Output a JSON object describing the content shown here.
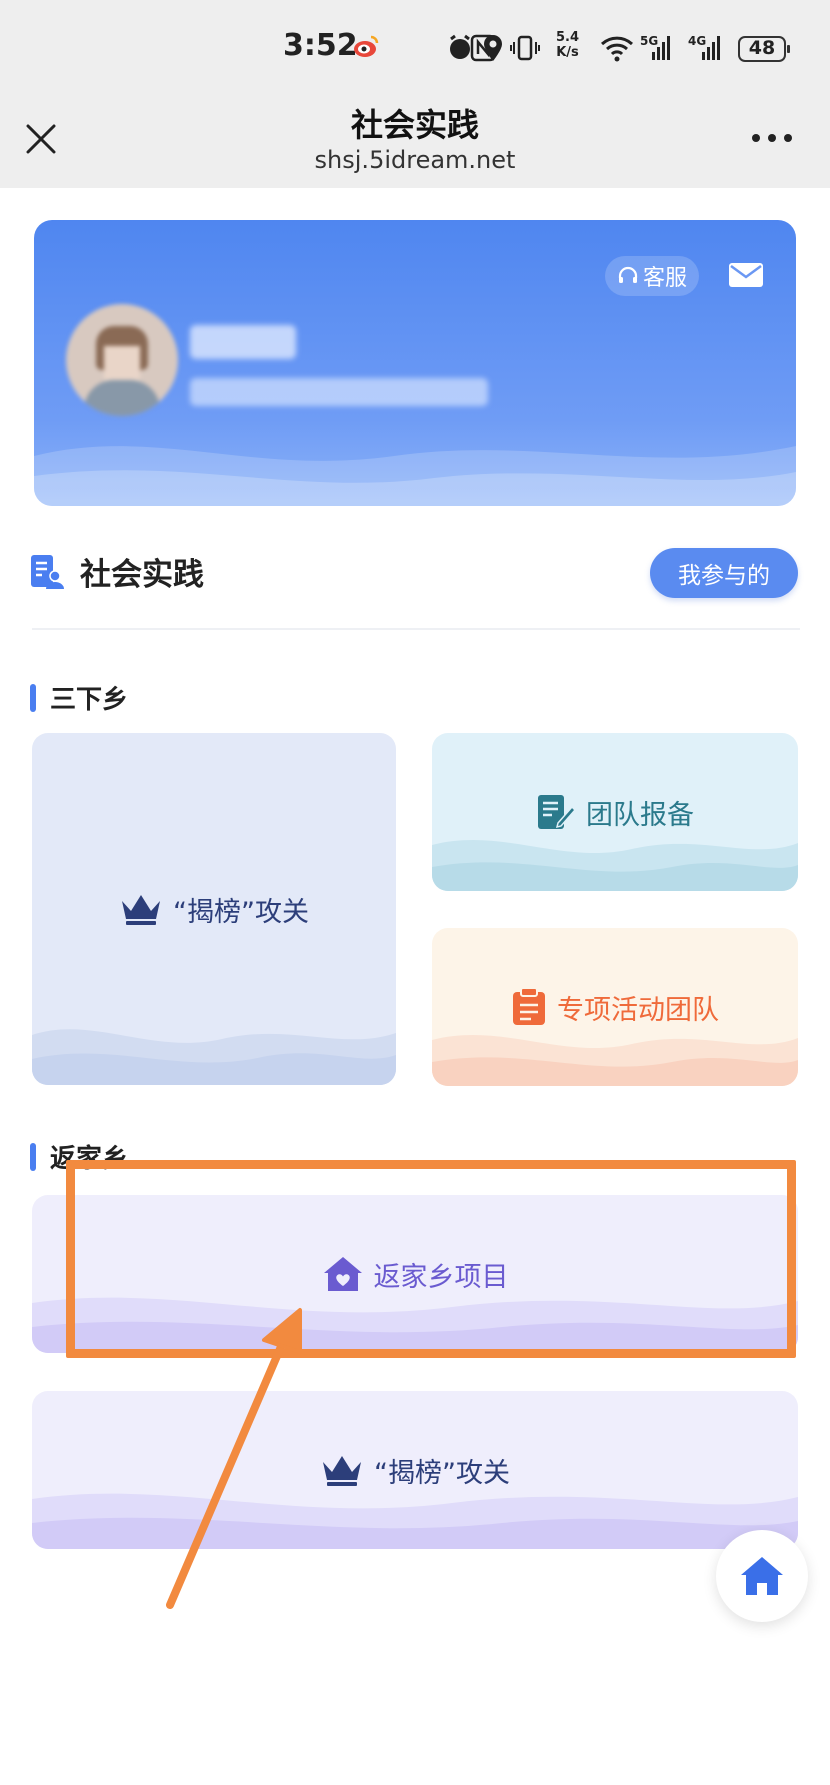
{
  "status_bar": {
    "time": "3:52",
    "net_speed_value": "5.4",
    "net_speed_unit": "K/s",
    "net_5g": "5G",
    "net_4g": "4G",
    "battery": "48"
  },
  "nav": {
    "title": "社会实践",
    "url": "shsj.5idream.net"
  },
  "profile": {
    "service_label": "客服"
  },
  "section": {
    "title": "社会实践",
    "mine_button": "我参与的"
  },
  "sanxiaxiang": {
    "title": "三下乡",
    "tiles": {
      "jiebang": "“揭榜”攻关",
      "team": "团队报备",
      "special": "专项活动团队"
    }
  },
  "fanjiaxiang": {
    "title": "返家乡",
    "tiles": {
      "project": "返家乡项目",
      "jiebang": "“揭榜”攻关"
    }
  },
  "colors": {
    "accent": "#4a7ef0",
    "navy": "#2c3e7a",
    "teal": "#2b7a8c",
    "orange": "#ef6a3a",
    "purple": "#6a5bd0",
    "annotation": "#f28a3f"
  }
}
